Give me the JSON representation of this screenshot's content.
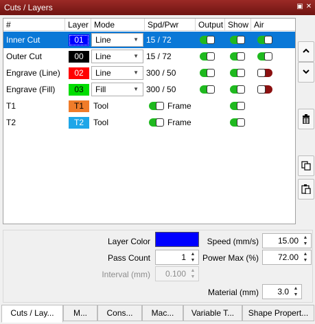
{
  "window": {
    "title": "Cuts / Layers"
  },
  "columns": [
    "#",
    "Layer",
    "Mode",
    "Spd/Pwr",
    "Output",
    "Show",
    "Air"
  ],
  "rows": [
    {
      "name": "Inner Cut",
      "layer": "01",
      "color": "#0000ff",
      "mode": "Line",
      "spdpwr": "15 / 72",
      "output": true,
      "show": true,
      "air": true,
      "selected": true
    },
    {
      "name": "Outer Cut",
      "layer": "00",
      "color": "#000000",
      "mode": "Line",
      "spdpwr": "15 / 72",
      "output": true,
      "show": true,
      "air": true,
      "selected": false
    },
    {
      "name": "Engrave (Line)",
      "layer": "02",
      "color": "#ff0000",
      "mode": "Line",
      "spdpwr": "300 / 50",
      "output": true,
      "show": true,
      "air": false,
      "selected": false
    },
    {
      "name": "Engrave (Fill)",
      "layer": "03",
      "color": "#00dd00",
      "mode": "Fill",
      "spdpwr": "300 / 50",
      "output": true,
      "show": true,
      "air": false,
      "selected": false
    },
    {
      "name": "T1",
      "layer": "T1",
      "color": "#f07c2a",
      "mode": "Tool",
      "frame_label": "Frame",
      "frame": true,
      "show": true
    },
    {
      "name": "T2",
      "layer": "T2",
      "color": "#1ea6e8",
      "mode": "Tool",
      "frame_label": "Frame",
      "frame": true,
      "show": true
    }
  ],
  "side_buttons": [
    "chevron-up-icon",
    "chevron-down-icon",
    "trash-icon",
    "copy-icon",
    "paste-icon"
  ],
  "properties": {
    "layer_color_label": "Layer Color",
    "layer_color": "#0000ff",
    "pass_count_label": "Pass Count",
    "pass_count": "1",
    "interval_label": "Interval (mm)",
    "interval": "0.100",
    "speed_label": "Speed (mm/s)",
    "speed": "15.00",
    "power_max_label": "Power Max (%)",
    "power_max": "72.00",
    "material_label": "Material (mm)",
    "material": "3.0"
  },
  "tabs": [
    "Cuts / Lay...",
    "M...",
    "Cons...",
    "Mac...",
    "Variable T...",
    "Shape Propert..."
  ],
  "active_tab": 0
}
